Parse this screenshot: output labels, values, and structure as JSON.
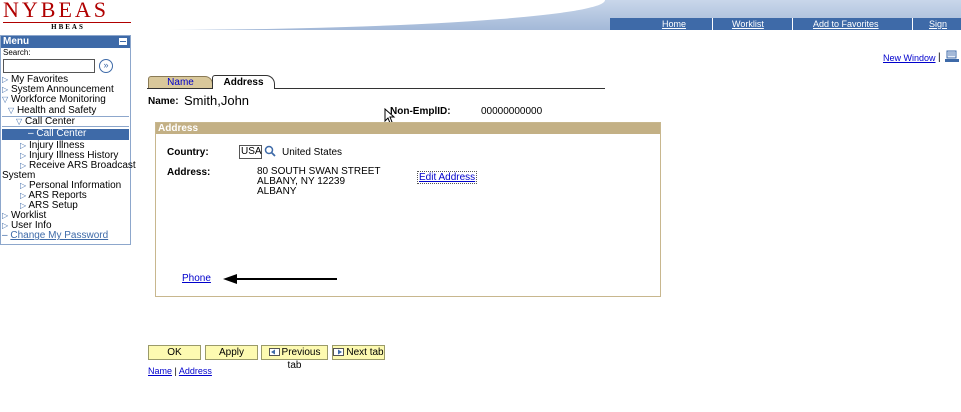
{
  "header": {
    "logo_main": "NYBEAS",
    "logo_sub": "HBEAS",
    "nav": {
      "home": "Home",
      "worklist": "Worklist",
      "add_to_favorites": "Add to Favorites",
      "sign_out": "Sign out"
    }
  },
  "menu": {
    "title": "Menu",
    "search_label": "Search:",
    "search_value": "",
    "items": [
      "My Favorites",
      "System Announcement",
      "Workforce Monitoring",
      "Health and Safety",
      "Call Center",
      "Call Center",
      "Injury Illness",
      "Injury Illness History",
      "Receive ARS Broadcast",
      "System",
      "Personal Information",
      "ARS Reports",
      "ARS Setup",
      "Worklist",
      "User Info",
      "Change My Password"
    ]
  },
  "toplinks": {
    "new_window": "New Window",
    "separator": "|"
  },
  "tabs": {
    "name": "Name",
    "address": "Address"
  },
  "employee": {
    "name_label": "Name:",
    "name_value": "Smith,John",
    "empid_label": "Non-EmplID:",
    "empid_value": "00000000000"
  },
  "address_box": {
    "header": "Address",
    "country_label": "Country:",
    "country_code": "USA",
    "country_desc": "United States",
    "address_label": "Address:",
    "address_lines": [
      "80 SOUTH SWAN STREET",
      "ALBANY, NY 12239",
      "ALBANY"
    ],
    "edit_address": "Edit Address",
    "phone_link": "Phone"
  },
  "buttons": {
    "ok": "OK",
    "apply": "Apply",
    "previous_tab": "Previous tab",
    "next_tab": "Next tab"
  },
  "bottom_links": {
    "name": "Name",
    "separator": "|",
    "address": "Address"
  },
  "colors": {
    "nav_blue": "#3e6aa8",
    "tab_tan": "#d9c89b",
    "group_header": "#c3b085",
    "button_yellow": "#fdfab1",
    "link": "#0000cc"
  }
}
